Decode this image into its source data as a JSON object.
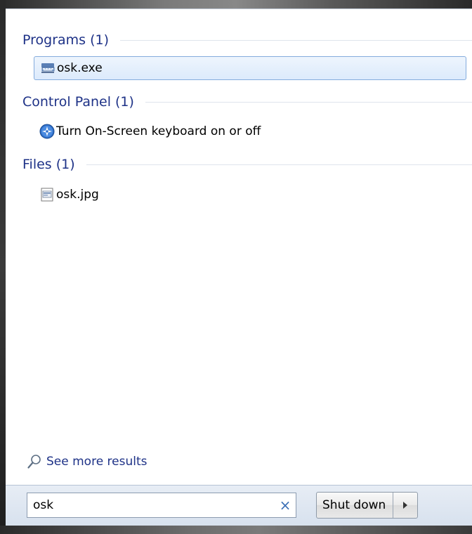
{
  "programs": {
    "header": "Programs (1)",
    "items": [
      {
        "label": "osk.exe",
        "icon": "keyboard-program-icon"
      }
    ]
  },
  "control_panel": {
    "header": "Control Panel (1)",
    "items": [
      {
        "label": "Turn On-Screen keyboard on or off",
        "icon": "ease-of-access-icon"
      }
    ]
  },
  "files": {
    "header": "Files (1)",
    "items": [
      {
        "label": "osk.jpg",
        "icon": "image-file-icon"
      }
    ]
  },
  "see_more": {
    "label": "See more results",
    "icon": "magnifier-icon"
  },
  "search": {
    "value": "osk",
    "clear_icon": "×"
  },
  "shutdown": {
    "label": "Shut down",
    "arrow_icon": "right-arrow-icon"
  },
  "colors": {
    "header_text": "#1e3287",
    "selection_border": "#84acdd",
    "selection_fill": "#dceafc"
  }
}
